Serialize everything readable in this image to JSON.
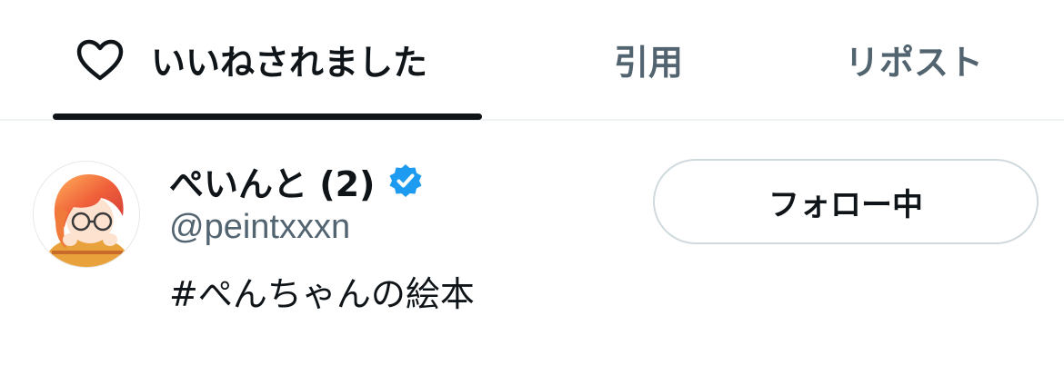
{
  "tabs": [
    {
      "label": "いいねされました",
      "icon": "heart-icon",
      "active": true
    },
    {
      "label": "引用",
      "active": false
    },
    {
      "label": "リポスト",
      "active": false
    }
  ],
  "user": {
    "display_name": "ぺいんと (2)",
    "handle": "@peintxxxn",
    "bio": "#ぺんちゃんの絵本",
    "verified": true,
    "verified_icon": "verified-badge-icon",
    "avatar": "avatar"
  },
  "follow_button": {
    "label": "フォロー中"
  },
  "colors": {
    "text_primary": "#0f1419",
    "text_secondary": "#536471",
    "verified_blue": "#1d9bf0",
    "border": "#cfd9de",
    "divider": "#eff3f4"
  }
}
